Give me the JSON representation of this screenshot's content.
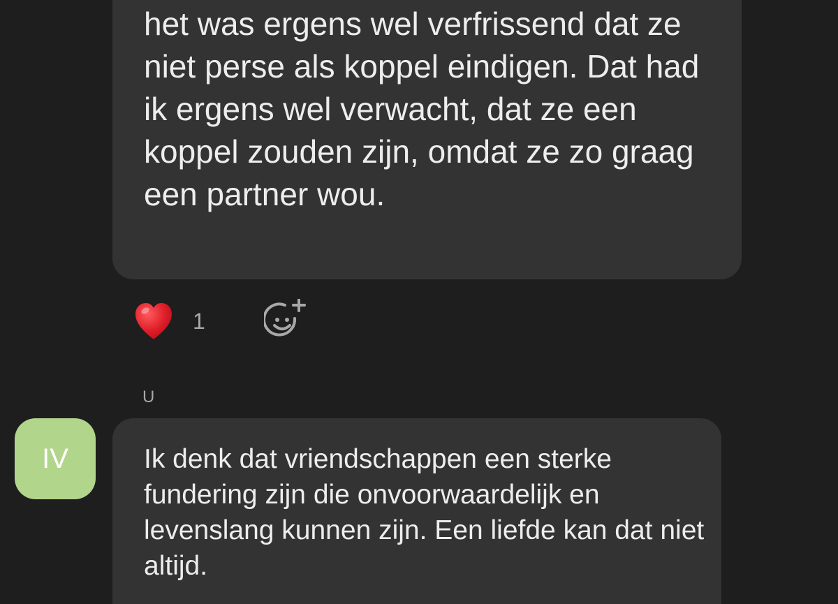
{
  "messages": [
    {
      "text": "het was ergens wel verfrissend dat ze niet perse als koppel eindigen. Dat had ik ergens wel verwacht, dat ze een koppel zouden zijn, omdat ze zo graag een partner wou.",
      "reactions": [
        {
          "emoji": "heart-icon",
          "count": "1"
        }
      ]
    },
    {
      "sender": "U",
      "avatar_initials": "IV",
      "avatar_color": "#b2d58c",
      "text": "Ik denk dat vriendschappen een sterke fundering zijn die onvoorwaardelijk en levenslang kunnen zijn. Een liefde kan dat niet altijd."
    }
  ],
  "colors": {
    "background": "#1e1e1e",
    "bubble": "#333333",
    "text": "#ededed",
    "muted": "#a8a8a8",
    "heart": "#e0202a"
  }
}
